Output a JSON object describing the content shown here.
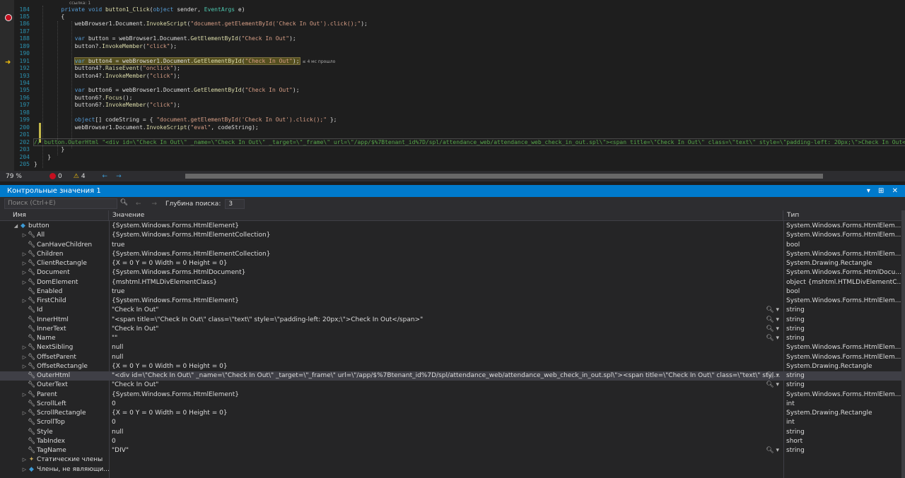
{
  "editor": {
    "refs_label": "ссылка: 1",
    "lines": [
      {
        "n": "184",
        "indent": 8,
        "parts": [
          [
            "kw",
            "private void "
          ],
          [
            "fn",
            "button1_Click"
          ],
          [
            "",
            "("
          ],
          [
            "kw",
            "object"
          ],
          [
            "",
            " sender, "
          ],
          [
            "ty",
            "EventArgs"
          ],
          [
            "",
            " e)"
          ]
        ]
      },
      {
        "n": "185",
        "indent": 8,
        "parts": [
          [
            "",
            "{"
          ]
        ]
      },
      {
        "n": "186",
        "indent": 12,
        "parts": [
          [
            "",
            "webBrowser1.Document."
          ],
          [
            "fn",
            "InvokeScript"
          ],
          [
            "",
            "("
          ],
          [
            "str",
            "\"document.getElementById('Check In Out').click();\""
          ],
          [
            "",
            ");"
          ]
        ]
      },
      {
        "n": "187",
        "indent": 0,
        "parts": []
      },
      {
        "n": "188",
        "indent": 12,
        "parts": [
          [
            "kw",
            "var"
          ],
          [
            "",
            " button = webBrowser1.Document."
          ],
          [
            "fn",
            "GetElementById"
          ],
          [
            "",
            "("
          ],
          [
            "str",
            "\"Check In Out\""
          ],
          [
            "",
            ");"
          ]
        ]
      },
      {
        "n": "189",
        "indent": 12,
        "parts": [
          [
            "",
            "button?."
          ],
          [
            "fn",
            "InvokeMember"
          ],
          [
            "",
            "("
          ],
          [
            "str",
            "\"click\""
          ],
          [
            "",
            ");"
          ]
        ]
      },
      {
        "n": "190",
        "indent": 0,
        "parts": []
      },
      {
        "n": "191",
        "indent": 12,
        "hl": true,
        "parts": [
          [
            "kw",
            "var"
          ],
          [
            "",
            " button4 = webBrowser1.Document."
          ],
          [
            "fn",
            "GetElementById"
          ],
          [
            "",
            "("
          ],
          [
            "str",
            "\"Check In Out\""
          ],
          [
            "",
            ");"
          ]
        ],
        "elapsed": "≤ 4 мс прошло"
      },
      {
        "n": "192",
        "indent": 12,
        "parts": [
          [
            "",
            "button4?."
          ],
          [
            "fn",
            "RaiseEvent"
          ],
          [
            "",
            "("
          ],
          [
            "str",
            "\"onclick\""
          ],
          [
            "",
            ");"
          ]
        ]
      },
      {
        "n": "193",
        "indent": 12,
        "parts": [
          [
            "",
            "button4?."
          ],
          [
            "fn",
            "InvokeMember"
          ],
          [
            "",
            "("
          ],
          [
            "str",
            "\"click\""
          ],
          [
            "",
            ");"
          ]
        ]
      },
      {
        "n": "194",
        "indent": 0,
        "parts": []
      },
      {
        "n": "195",
        "indent": 12,
        "parts": [
          [
            "kw",
            "var"
          ],
          [
            "",
            " button6 = webBrowser1.Document."
          ],
          [
            "fn",
            "GetElementById"
          ],
          [
            "",
            "("
          ],
          [
            "str",
            "\"Check In Out\""
          ],
          [
            "",
            ");"
          ]
        ]
      },
      {
        "n": "196",
        "indent": 12,
        "parts": [
          [
            "",
            "button6?."
          ],
          [
            "fn",
            "Focus"
          ],
          [
            "",
            "();"
          ]
        ]
      },
      {
        "n": "197",
        "indent": 12,
        "parts": [
          [
            "",
            "button6?."
          ],
          [
            "fn",
            "InvokeMember"
          ],
          [
            "",
            "("
          ],
          [
            "str",
            "\"click\""
          ],
          [
            "",
            ");"
          ]
        ]
      },
      {
        "n": "198",
        "indent": 0,
        "parts": []
      },
      {
        "n": "199",
        "indent": 12,
        "parts": [
          [
            "kw",
            "object"
          ],
          [
            "",
            "[] codeString = { "
          ],
          [
            "str",
            "\"document.getElementById('Check In Out').click();\""
          ],
          [
            "",
            " };"
          ]
        ]
      },
      {
        "n": "200",
        "indent": 12,
        "parts": [
          [
            "",
            "webBrowser1.Document."
          ],
          [
            "fn",
            "InvokeScript"
          ],
          [
            "",
            "("
          ],
          [
            "str",
            "\"eval\""
          ],
          [
            "",
            ", codeString);"
          ]
        ]
      },
      {
        "n": "201",
        "indent": 0,
        "parts": []
      },
      {
        "n": "202",
        "indent": 0,
        "comment": true,
        "parts": [
          [
            "cm",
            "// button.OuterHtml \"<div id=\\\"Check In Out\\\" _name=\\\"Check In Out\\\" _target=\\\"_frame\\\" url=\\\"/app/$%7Btenant_id%7D/spl/attendance_web/attendance_web_check_in_out.spl\\\"><span title=\\\"Check In Out\\\" class=\\\"text\\\" style=\\\"padding-left: 20px;\\\">Check In Out</span></div>\""
          ]
        ]
      },
      {
        "n": "203",
        "indent": 8,
        "parts": [
          [
            "",
            "}"
          ]
        ]
      },
      {
        "n": "204",
        "indent": 4,
        "parts": [
          [
            "",
            "}"
          ]
        ]
      },
      {
        "n": "205",
        "indent": 0,
        "parts": [
          [
            "",
            "}"
          ]
        ]
      }
    ]
  },
  "status": {
    "zoom": "79 %",
    "errors": "0",
    "warnings": "4"
  },
  "watch": {
    "title": "Контрольные значения 1",
    "title_tools": "▾ ⊞ ✕",
    "search_placeholder": "Поиск (Ctrl+E)",
    "nav_arrows": "← →",
    "depth_label": "Глубина поиска:",
    "depth_value": "3",
    "columns": {
      "name": "Имя",
      "value": "Значение",
      "type": "Тип"
    },
    "rows": [
      {
        "level": 0,
        "exp": "◢",
        "icon": "cube",
        "name": "button",
        "value": "{System.Windows.Forms.HtmlElement}",
        "type": "System.Windows.Forms.HtmlElem..."
      },
      {
        "level": 1,
        "exp": "▷",
        "icon": "wrench",
        "name": "All",
        "value": "{System.Windows.Forms.HtmlElementCollection}",
        "type": "System.Windows.Forms.HtmlElem..."
      },
      {
        "level": 1,
        "exp": "",
        "icon": "wrench",
        "name": "CanHaveChildren",
        "value": "true",
        "type": "bool"
      },
      {
        "level": 1,
        "exp": "▷",
        "icon": "wrench",
        "name": "Children",
        "value": "{System.Windows.Forms.HtmlElementCollection}",
        "type": "System.Windows.Forms.HtmlElem..."
      },
      {
        "level": 1,
        "exp": "▷",
        "icon": "wrench",
        "name": "ClientRectangle",
        "value": "{X = 0 Y = 0 Width = 0 Height = 0}",
        "type": "System.Drawing.Rectangle"
      },
      {
        "level": 1,
        "exp": "▷",
        "icon": "wrench",
        "name": "Document",
        "value": "{System.Windows.Forms.HtmlDocument}",
        "type": "System.Windows.Forms.HtmlDocu..."
      },
      {
        "level": 1,
        "exp": "▷",
        "icon": "wrench",
        "name": "DomElement",
        "value": "{mshtml.HTMLDivElementClass}",
        "type": "object {mshtml.HTMLDivElementC..."
      },
      {
        "level": 1,
        "exp": "",
        "icon": "wrench",
        "name": "Enabled",
        "value": "true",
        "type": "bool"
      },
      {
        "level": 1,
        "exp": "▷",
        "icon": "wrench",
        "name": "FirstChild",
        "value": "{System.Windows.Forms.HtmlElement}",
        "type": "System.Windows.Forms.HtmlElem..."
      },
      {
        "level": 1,
        "exp": "",
        "icon": "wrench",
        "name": "Id",
        "value": "\"Check In Out\"",
        "type": "string",
        "viz": true
      },
      {
        "level": 1,
        "exp": "",
        "icon": "wrench",
        "name": "InnerHtml",
        "value": "\"<span title=\\\"Check In Out\\\" class=\\\"text\\\" style=\\\"padding-left: 20px;\\\">Check In Out</span>\"",
        "type": "string",
        "viz": true
      },
      {
        "level": 1,
        "exp": "",
        "icon": "wrench",
        "name": "InnerText",
        "value": "\"Check In Out\"",
        "type": "string",
        "viz": true
      },
      {
        "level": 1,
        "exp": "",
        "icon": "wrench",
        "name": "Name",
        "value": "\"\"",
        "type": "string",
        "viz": true
      },
      {
        "level": 1,
        "exp": "▷",
        "icon": "wrench",
        "name": "NextSibling",
        "value": "null",
        "type": "System.Windows.Forms.HtmlElem..."
      },
      {
        "level": 1,
        "exp": "▷",
        "icon": "wrench",
        "name": "OffsetParent",
        "value": "null",
        "type": "System.Windows.Forms.HtmlElem..."
      },
      {
        "level": 1,
        "exp": "▷",
        "icon": "wrench",
        "name": "OffsetRectangle",
        "value": "{X = 0 Y = 0 Width = 0 Height = 0}",
        "type": "System.Drawing.Rectangle"
      },
      {
        "level": 1,
        "exp": "",
        "icon": "wrench",
        "name": "OuterHtml",
        "selected": true,
        "value": "\"<div id=\\\"Check In Out\\\" _name=\\\"Check In Out\\\" _target=\\\"_frame\\\" url=\\\"/app/$%7Btenant_id%7D/spl/attendance_web/attendance_web_check_in_out.spl\\\"><span title=\\\"Check In Out\\\" class=\\\"text\\\" style=\\\"padding-...",
        "type": "string",
        "viz": true
      },
      {
        "level": 1,
        "exp": "",
        "icon": "wrench",
        "name": "OuterText",
        "value": "\"Check In Out\"",
        "type": "string",
        "viz": true
      },
      {
        "level": 1,
        "exp": "▷",
        "icon": "wrench",
        "name": "Parent",
        "value": "{System.Windows.Forms.HtmlElement}",
        "type": "System.Windows.Forms.HtmlElem..."
      },
      {
        "level": 1,
        "exp": "",
        "icon": "wrench",
        "name": "ScrollLeft",
        "value": "0",
        "type": "int"
      },
      {
        "level": 1,
        "exp": "▷",
        "icon": "wrench",
        "name": "ScrollRectangle",
        "value": "{X = 0 Y = 0 Width = 0 Height = 0}",
        "type": "System.Drawing.Rectangle"
      },
      {
        "level": 1,
        "exp": "",
        "icon": "wrench",
        "name": "ScrollTop",
        "value": "0",
        "type": "int"
      },
      {
        "level": 1,
        "exp": "",
        "icon": "wrench",
        "name": "Style",
        "value": "null",
        "type": "string"
      },
      {
        "level": 1,
        "exp": "",
        "icon": "wrench",
        "name": "TabIndex",
        "value": "0",
        "type": "short"
      },
      {
        "level": 1,
        "exp": "",
        "icon": "wrench",
        "name": "TagName",
        "value": "\"DIV\"",
        "type": "string",
        "viz": true
      },
      {
        "level": 1,
        "exp": "▷",
        "icon": "stat",
        "name": "Статические члены",
        "value": "",
        "type": ""
      },
      {
        "level": 1,
        "exp": "▷",
        "icon": "cube",
        "name": "Члены, не являющи...",
        "value": "",
        "type": ""
      }
    ]
  },
  "colors": {
    "accent": "#007acc",
    "breakpoint": "#c50f1f",
    "current_line": "#554f1f"
  },
  "icons": {
    "wrench": "wrench-icon",
    "cube": "object-icon",
    "stat": "static-members-icon",
    "search": "search-icon",
    "magnifier_viz": "magnifier-visualizer-icon"
  }
}
